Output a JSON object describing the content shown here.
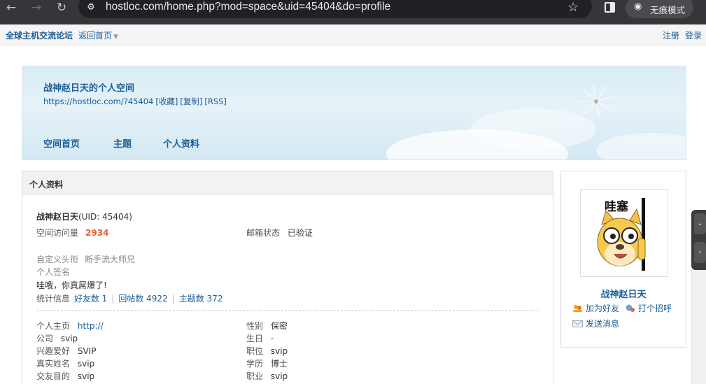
{
  "browser": {
    "url": "hostloc.com/home.php?mod=space&uid=45404&do=profile",
    "incognito_label": "无痕模式",
    "icons": {
      "back": "arrow-left-icon",
      "forward": "arrow-right-icon",
      "reload": "reload-icon",
      "site_info": "tune-icon",
      "bookmark": "star-icon",
      "side_panel": "side-panel-icon",
      "incognito": "incognito-icon"
    }
  },
  "topbar": {
    "site_name": "全球主机交流论坛",
    "back_home": "返回首页",
    "register": "注册",
    "login": "登录"
  },
  "banner": {
    "title": "战神赵日天的个人空间",
    "url": "https://hostloc.com/?45404",
    "favorite": "[收藏]",
    "copy": "[复制]",
    "rss": "[RSS]",
    "nav": [
      "空间首页",
      "主题",
      "个人资料"
    ]
  },
  "profile": {
    "section_title": "个人资料",
    "username": "战神赵日天",
    "uid": "(UID: 45404)",
    "visits_label": "空间访问量",
    "visits": "2934",
    "email_label": "邮箱状态",
    "email_value": "已验证",
    "custom_title_label": "自定义头衔",
    "custom_title_value": "断手流大师兄",
    "signature_label": "个人签名",
    "signature_value": "哇哦，你真屌爆了!",
    "stats_label": "统计信息",
    "friends": "好友数 1",
    "replies": "回帖数 4922",
    "threads": "主题数 372",
    "details_left": [
      {
        "label": "个人主页",
        "value": "http://"
      },
      {
        "label": "公司",
        "value": "svip"
      },
      {
        "label": "兴趣爱好",
        "value": "SVIP"
      },
      {
        "label": "真实姓名",
        "value": "svip"
      },
      {
        "label": "交友目的",
        "value": "svip"
      }
    ],
    "details_right": [
      {
        "label": "性别",
        "value": "保密"
      },
      {
        "label": "生日",
        "value": "-"
      },
      {
        "label": "职位",
        "value": "svip"
      },
      {
        "label": "学历",
        "value": "博士"
      },
      {
        "label": "职业",
        "value": "svip"
      }
    ]
  },
  "sidebar": {
    "avatar_text": "哇塞",
    "name": "战神赵日天",
    "add_friend": "加为好友",
    "greet": "打个招呼",
    "send_message": "发送消息"
  }
}
